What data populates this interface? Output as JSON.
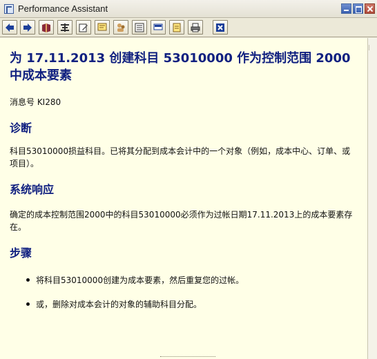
{
  "window": {
    "title": "Performance Assistant"
  },
  "toolbar": {
    "buttons": [
      {
        "name": "back-icon"
      },
      {
        "name": "forward-icon"
      },
      {
        "name": "book-icon"
      },
      {
        "name": "settings-icon"
      },
      {
        "name": "edit-icon"
      },
      {
        "name": "note-icon"
      },
      {
        "name": "users-icon"
      },
      {
        "name": "document-icon"
      },
      {
        "name": "comment-icon"
      },
      {
        "name": "stamp-icon"
      },
      {
        "name": "print-icon"
      },
      {
        "name": "close-window-icon"
      }
    ]
  },
  "content": {
    "title": "为 17.11.2013 创建科目 53010000 作为控制范围 2000 中成本要素",
    "message_number": "消息号 KI280",
    "sections": [
      {
        "heading": "诊断",
        "text": "科目53010000损益科目。已将其分配到成本会计中的一个对象（例如，成本中心、订单、或项目）。"
      },
      {
        "heading": "系统响应",
        "text": "确定的成本控制范围2000中的科目53010000必须作为过帐日期17.11.2013上的成本要素存在。"
      },
      {
        "heading": "步骤",
        "steps": [
          "将科目53010000创建为成本要素，然后重复您的过帐。",
          "或，删除对成本会计的对象的辅助科目分配。"
        ]
      }
    ]
  },
  "colors": {
    "background": "#ffffe7",
    "heading": "#102080"
  }
}
